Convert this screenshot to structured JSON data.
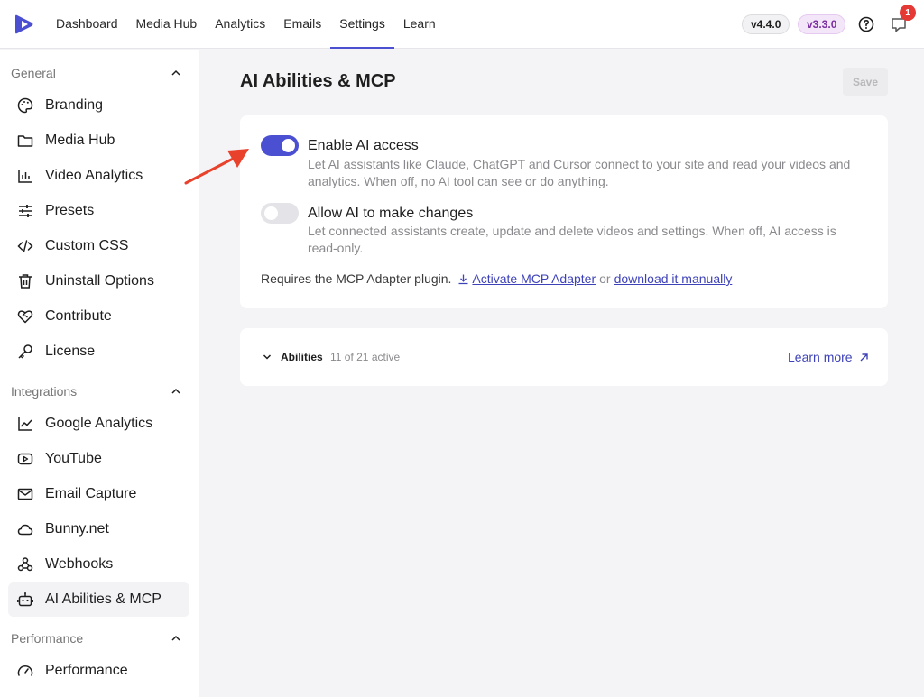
{
  "nav": {
    "items": [
      {
        "label": "Dashboard"
      },
      {
        "label": "Media Hub"
      },
      {
        "label": "Analytics"
      },
      {
        "label": "Emails"
      },
      {
        "label": "Settings",
        "active": true
      },
      {
        "label": "Learn"
      }
    ],
    "version_primary": "v4.4.0",
    "version_secondary": "v3.3.0",
    "notification_count": "1"
  },
  "sidebar": {
    "general": {
      "heading": "General",
      "items": [
        {
          "label": "Branding",
          "icon": "palette-icon"
        },
        {
          "label": "Media Hub",
          "icon": "folder-icon"
        },
        {
          "label": "Video Analytics",
          "icon": "bar-chart-icon"
        },
        {
          "label": "Presets",
          "icon": "sliders-icon"
        },
        {
          "label": "Custom CSS",
          "icon": "code-icon"
        },
        {
          "label": "Uninstall Options",
          "icon": "trash-icon"
        },
        {
          "label": "Contribute",
          "icon": "heart-handshake-icon"
        },
        {
          "label": "License",
          "icon": "key-icon"
        }
      ]
    },
    "integrations": {
      "heading": "Integrations",
      "items": [
        {
          "label": "Google Analytics",
          "icon": "line-chart-icon"
        },
        {
          "label": "YouTube",
          "icon": "youtube-icon"
        },
        {
          "label": "Email Capture",
          "icon": "mail-icon"
        },
        {
          "label": "Bunny.net",
          "icon": "cloud-icon"
        },
        {
          "label": "Webhooks",
          "icon": "webhook-icon"
        },
        {
          "label": "AI Abilities & MCP",
          "icon": "robot-icon",
          "active": true
        }
      ]
    },
    "performance": {
      "heading": "Performance",
      "items": [
        {
          "label": "Performance",
          "icon": "gauge-icon"
        }
      ]
    }
  },
  "main": {
    "title": "AI Abilities & MCP",
    "save_label": "Save",
    "options": [
      {
        "title": "Enable AI access",
        "description": "Let AI assistants like Claude, ChatGPT and Cursor connect to your site and read your videos and analytics. When off, no AI tool can see or do anything.",
        "enabled": true
      },
      {
        "title": "Allow AI to make changes",
        "description": "Let connected assistants create, update and delete videos and settings. When off, AI access is read-only.",
        "enabled": false
      }
    ],
    "requires_text": "Requires the MCP Adapter plugin.",
    "activate_link": "Activate MCP Adapter",
    "or_text": "or",
    "download_link": "download it manually",
    "abilities": {
      "label": "Abilities",
      "count": "11 of 21 active",
      "learn_more": "Learn more"
    }
  },
  "colors": {
    "accent": "#4b4fd1",
    "link": "#3e42b8",
    "annotation_arrow": "#e8412c"
  }
}
